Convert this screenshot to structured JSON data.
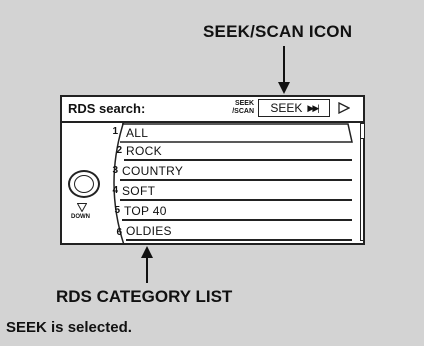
{
  "callouts": {
    "top": "SEEK/SCAN ICON",
    "bottom": "RDS CATEGORY LIST",
    "caption": "SEEK is selected."
  },
  "screen": {
    "title": "RDS search:",
    "seek_small_line1": "SEEK",
    "seek_small_line2": "/SCAN",
    "seek_button": "SEEK",
    "seek_button_icon": "fast-forward-icon",
    "next_icon": "play-triangle-icon",
    "down_label": "DOWN"
  },
  "categories": [
    {
      "num": "1",
      "label": "ALL",
      "selected": true
    },
    {
      "num": "2",
      "label": "ROCK",
      "selected": false
    },
    {
      "num": "3",
      "label": "COUNTRY",
      "selected": false
    },
    {
      "num": "4",
      "label": "SOFT",
      "selected": false
    },
    {
      "num": "5",
      "label": "TOP 40",
      "selected": false
    },
    {
      "num": "6",
      "label": "OLDIES",
      "selected": false
    }
  ]
}
